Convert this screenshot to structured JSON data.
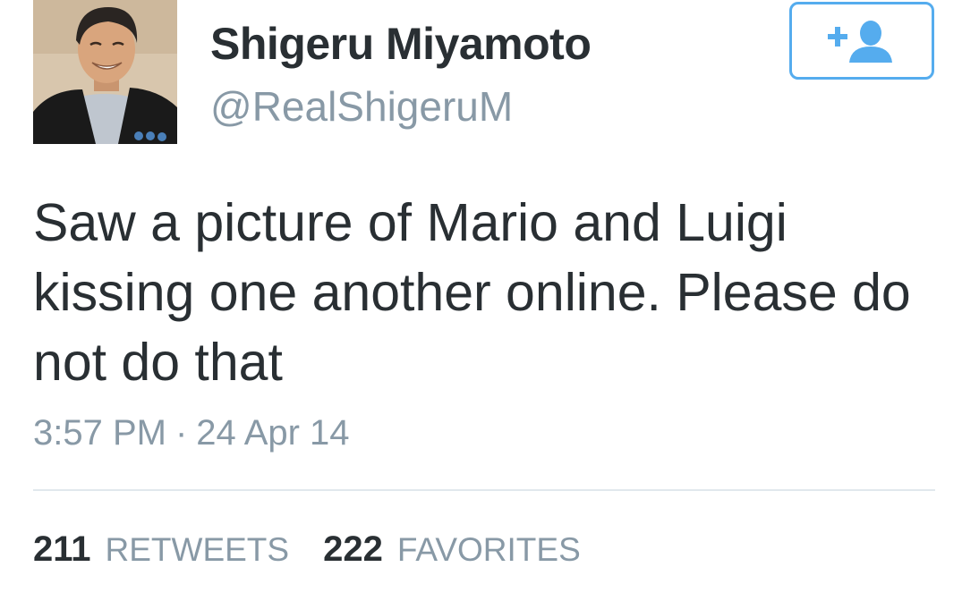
{
  "author": {
    "display_name": "Shigeru Miyamoto",
    "handle": "@RealShigeruM",
    "avatar_icon": "profile-photo"
  },
  "follow_button": {
    "icon": "add-user-icon",
    "accent_color": "#55acee"
  },
  "tweet": {
    "text": "Saw a picture of Mario and Luigi kissing one another online. Please do not do that",
    "time": "3:57 PM",
    "separator": "·",
    "date": "24 Apr 14"
  },
  "stats": {
    "retweets_count": "211",
    "retweets_label": "RETWEETS",
    "favorites_count": "222",
    "favorites_label": "FAVORITES"
  }
}
